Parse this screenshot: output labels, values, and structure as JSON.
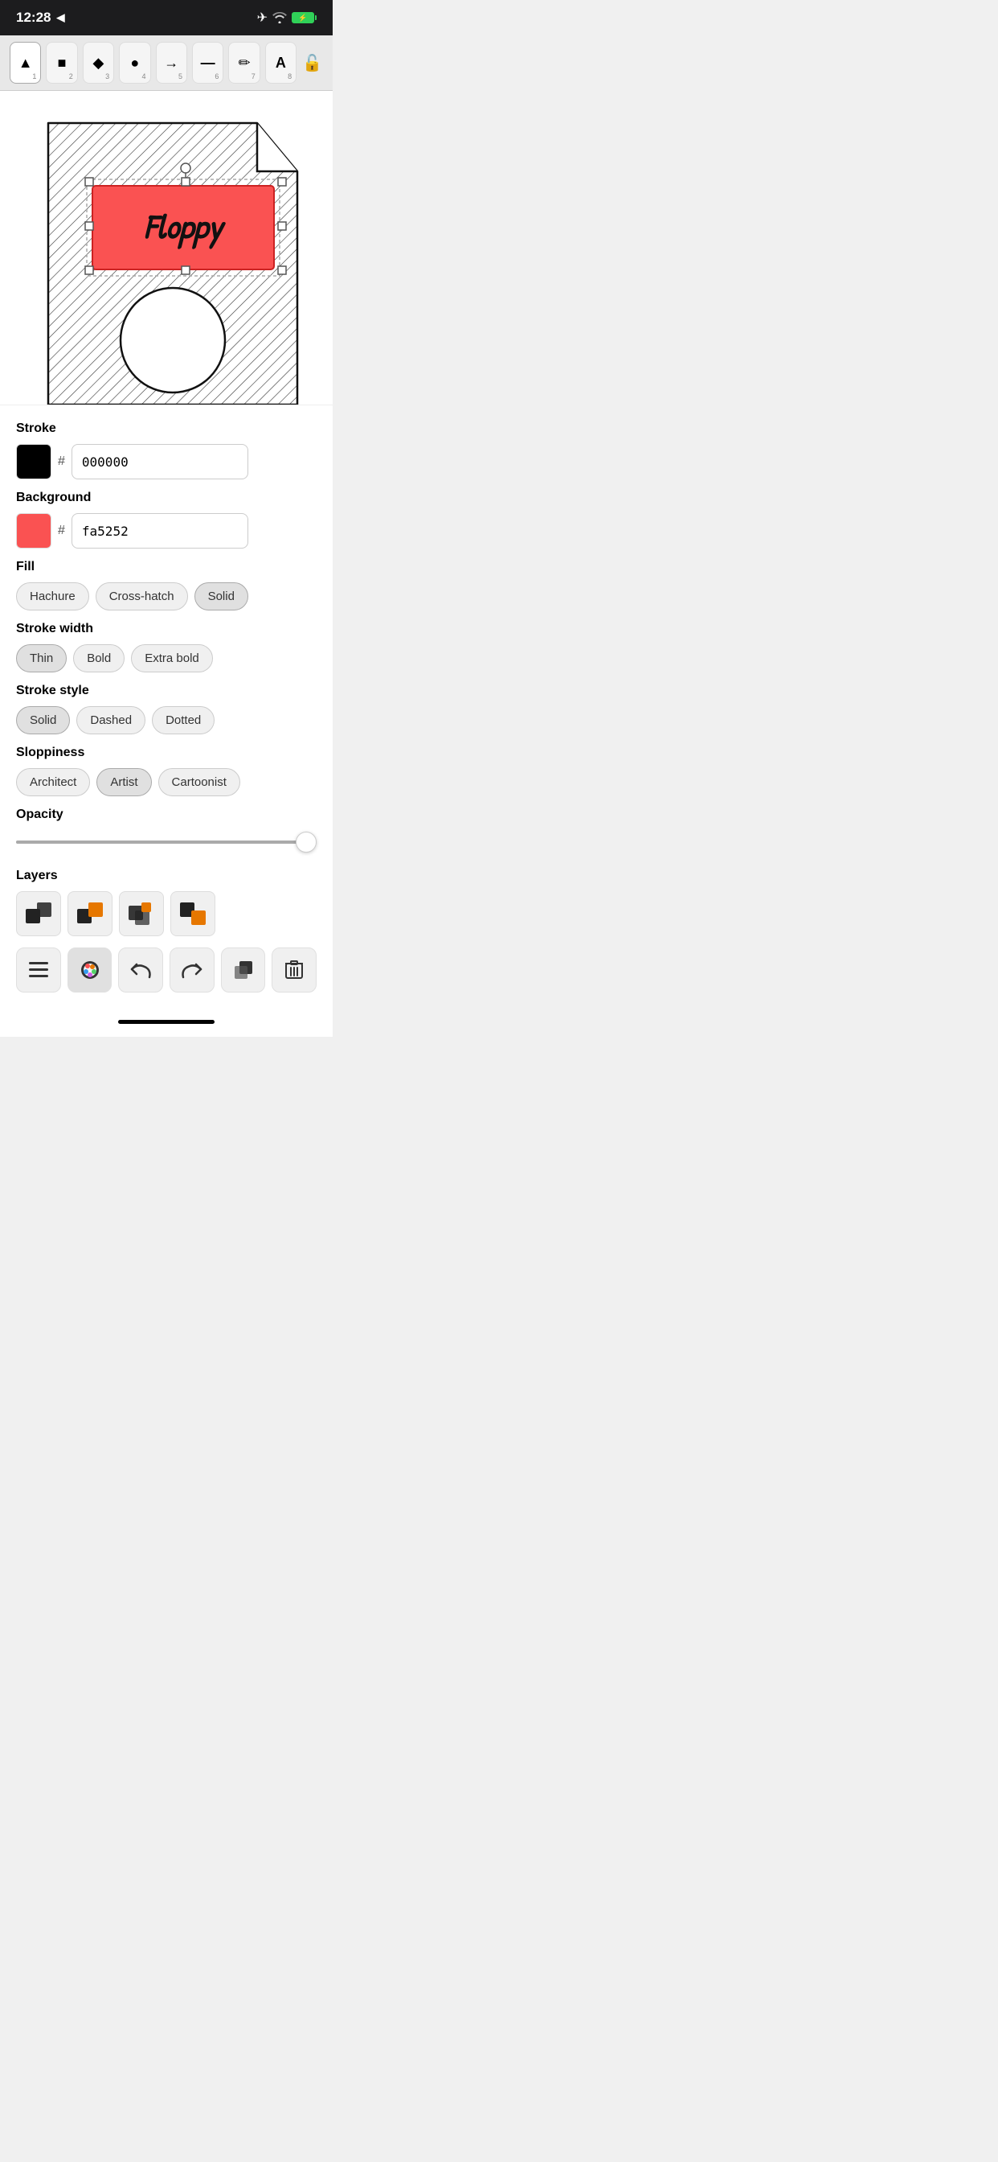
{
  "status": {
    "time": "12:28",
    "location_icon": "◀",
    "wifi": "wifi",
    "battery": "⚡"
  },
  "toolbar": {
    "tools": [
      {
        "id": "select",
        "icon": "▲",
        "num": "1",
        "active": false
      },
      {
        "id": "rect",
        "icon": "■",
        "num": "2",
        "active": false
      },
      {
        "id": "diamond",
        "icon": "◆",
        "num": "3",
        "active": false
      },
      {
        "id": "circle",
        "icon": "●",
        "num": "4",
        "active": false
      },
      {
        "id": "arrow",
        "icon": "→",
        "num": "5",
        "active": false
      },
      {
        "id": "line",
        "icon": "—",
        "num": "6",
        "active": false
      },
      {
        "id": "pencil",
        "icon": "✏",
        "num": "7",
        "active": false
      },
      {
        "id": "text",
        "icon": "A",
        "num": "8",
        "active": false
      }
    ],
    "lock_icon": "🔓"
  },
  "canvas": {
    "label": "canvas-drawing"
  },
  "properties": {
    "stroke_label": "Stroke",
    "stroke_color": "#000000",
    "stroke_hex": "000000",
    "background_label": "Background",
    "background_color": "#fa5252",
    "background_hex": "fa5252",
    "fill_label": "Fill",
    "fill_options": [
      {
        "label": "Hachure",
        "active": false
      },
      {
        "label": "Cross-hatch",
        "active": false
      },
      {
        "label": "Solid",
        "active": true
      }
    ],
    "stroke_width_label": "Stroke width",
    "stroke_width_options": [
      {
        "label": "Thin",
        "active": true
      },
      {
        "label": "Bold",
        "active": false
      },
      {
        "label": "Extra bold",
        "active": false
      }
    ],
    "stroke_style_label": "Stroke style",
    "stroke_style_options": [
      {
        "label": "Solid",
        "active": true
      },
      {
        "label": "Dashed",
        "active": false
      },
      {
        "label": "Dotted",
        "active": false
      }
    ],
    "sloppiness_label": "Sloppiness",
    "sloppiness_options": [
      {
        "label": "Architect",
        "active": false
      },
      {
        "label": "Artist",
        "active": true
      },
      {
        "label": "Cartoonist",
        "active": false
      }
    ],
    "opacity_label": "Opacity",
    "opacity_value": 100,
    "layers_label": "Layers",
    "layer_icons": [
      {
        "id": "layer1",
        "unicode": "⬛"
      },
      {
        "id": "layer2",
        "unicode": "🟧"
      },
      {
        "id": "layer3",
        "unicode": "🔳"
      },
      {
        "id": "layer4",
        "unicode": "🟧"
      }
    ],
    "action_buttons": [
      {
        "id": "menu",
        "icon": "☰"
      },
      {
        "id": "style",
        "icon": "🎨",
        "active": true
      },
      {
        "id": "undo",
        "icon": "↩"
      },
      {
        "id": "redo",
        "icon": "↪"
      },
      {
        "id": "copy",
        "icon": "⧉"
      },
      {
        "id": "delete",
        "icon": "🗑"
      }
    ]
  }
}
